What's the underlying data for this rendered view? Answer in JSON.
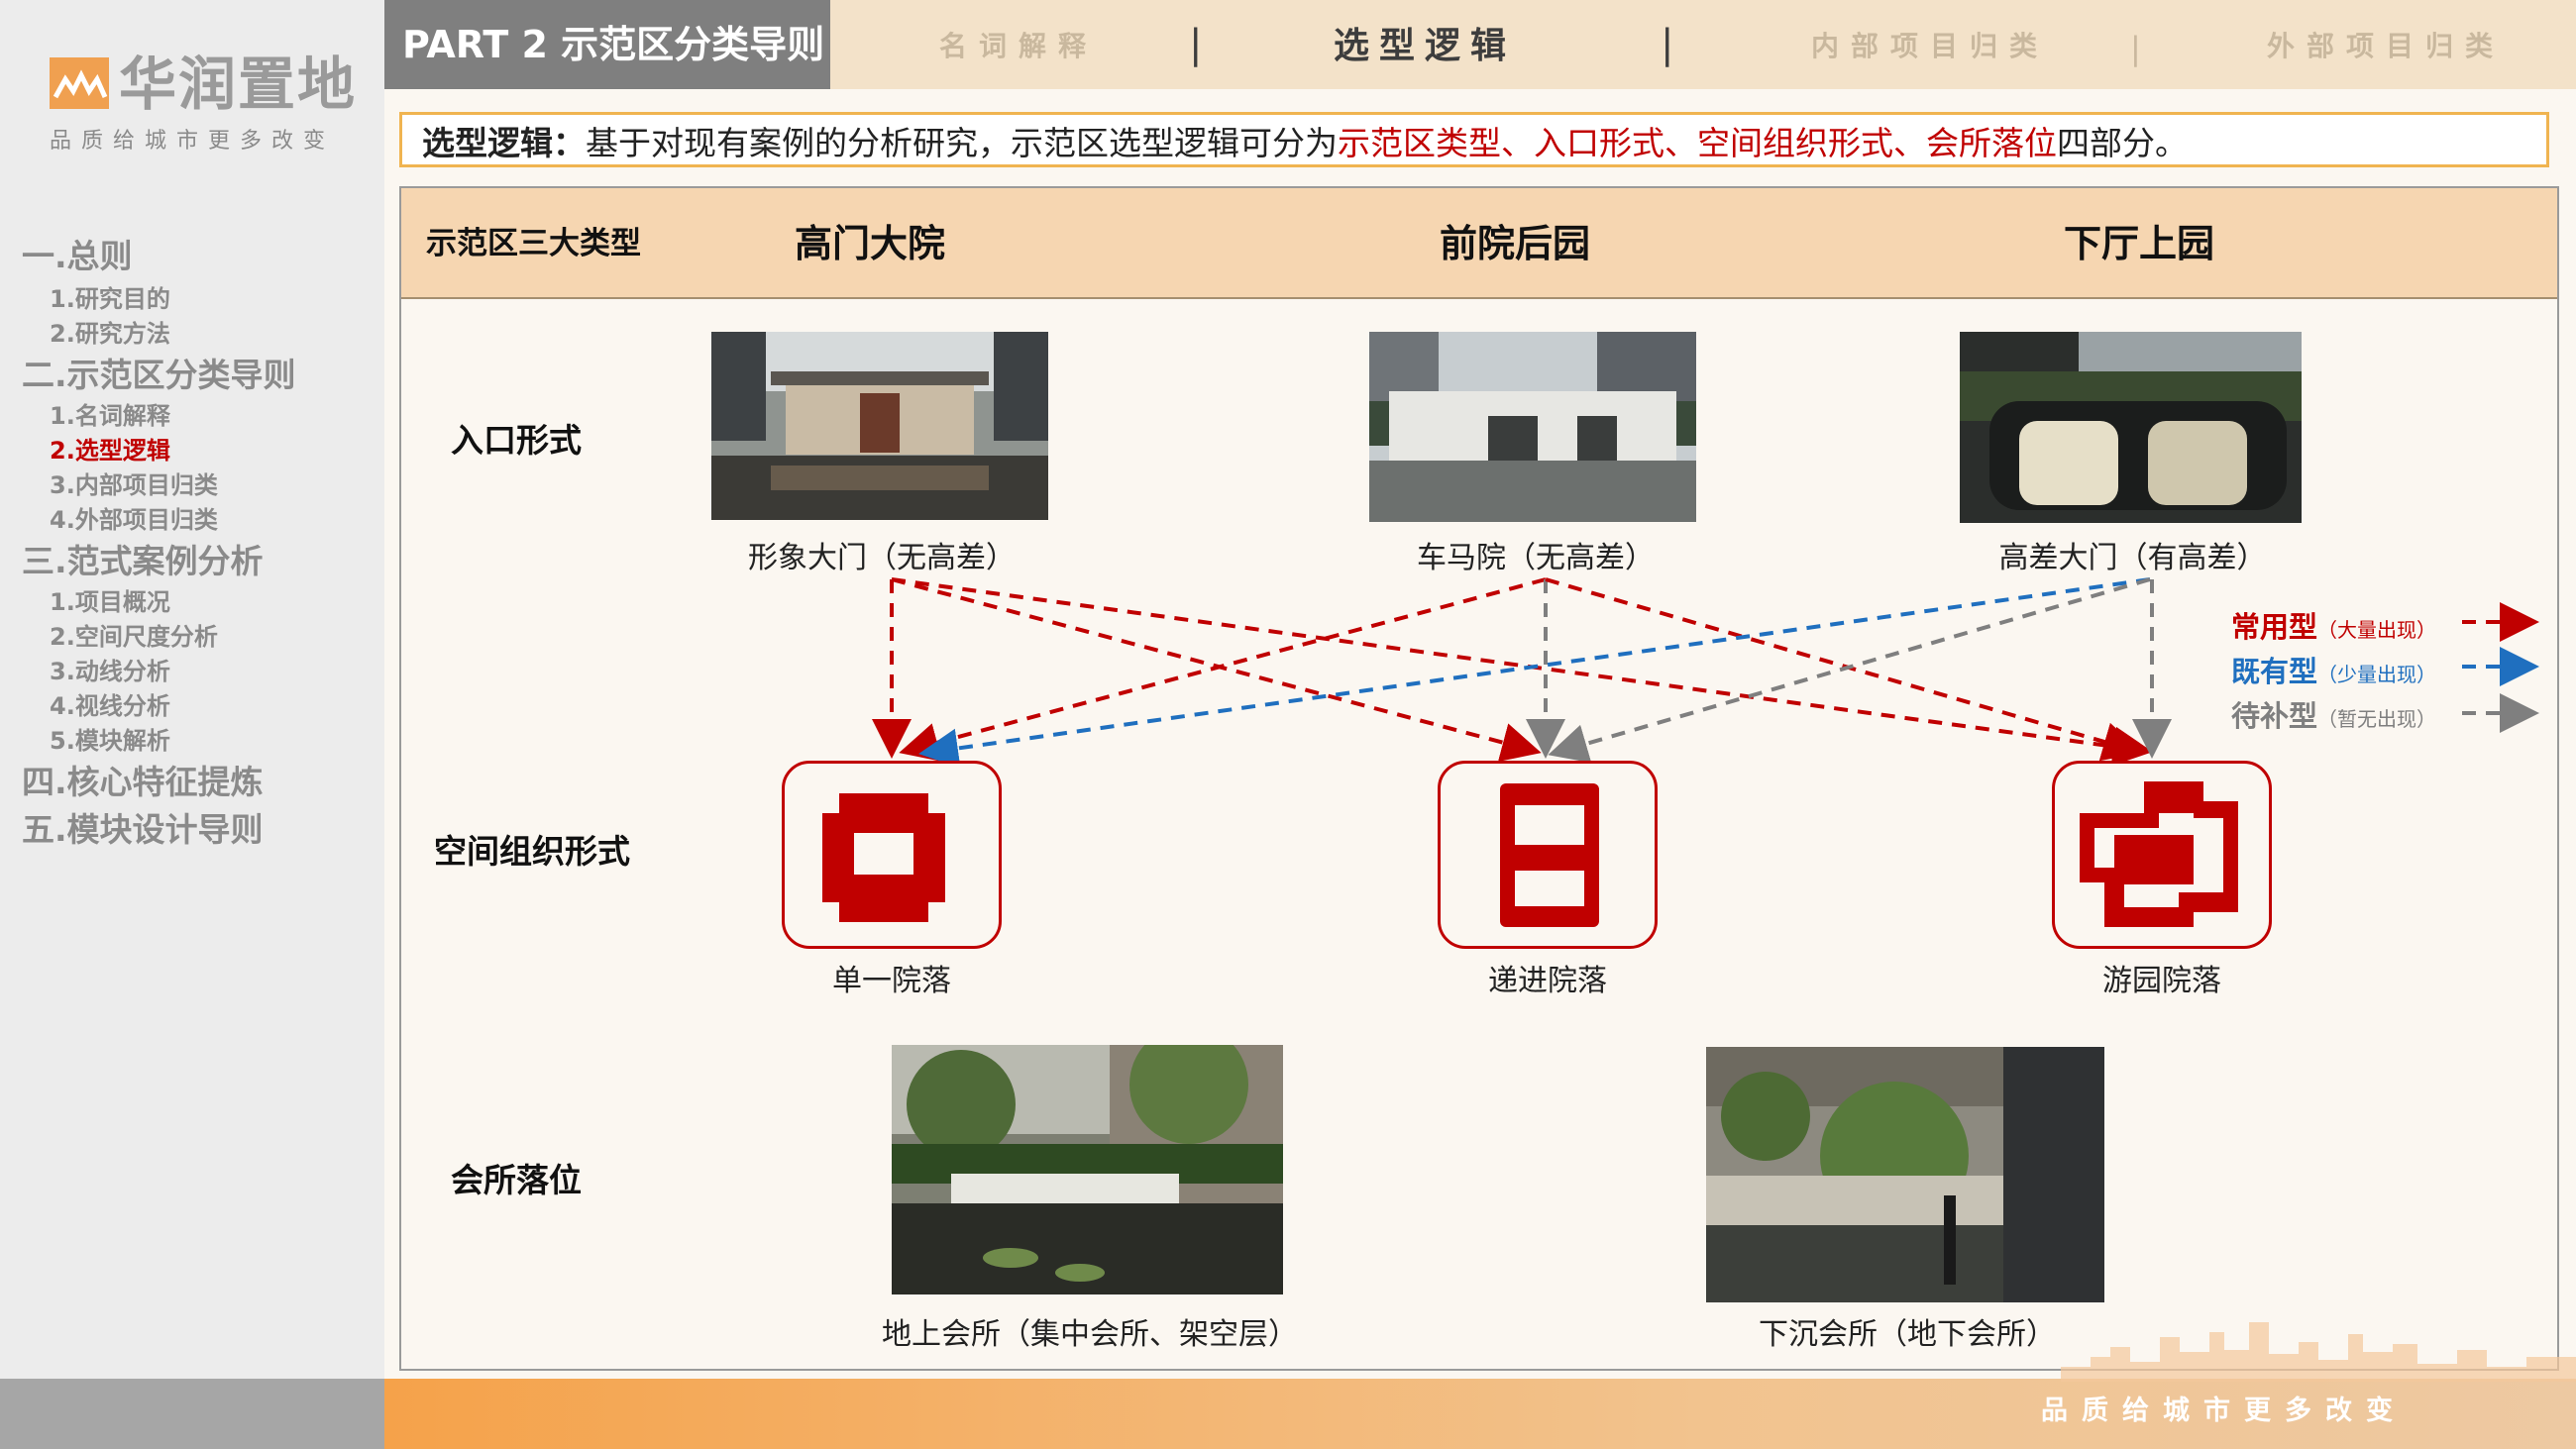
{
  "brand": {
    "name": "华润置地",
    "tagline": "品质给城市更多改变"
  },
  "sidebar": {
    "sections": [
      {
        "label": "一.总则",
        "items": [
          "1.研究目的",
          "2.研究方法"
        ]
      },
      {
        "label": "二.示范区分类导则",
        "items": [
          "1.名词解释",
          "2.选型逻辑",
          "3.内部项目归类",
          "4.外部项目归类"
        ]
      },
      {
        "label": "三.范式案例分析",
        "items": [
          "1.项目概况",
          "2.空间尺度分析",
          "3.动线分析",
          "4.视线分析",
          "5.模块解析"
        ]
      },
      {
        "label": "四.核心特征提炼",
        "items": []
      },
      {
        "label": "五.模块设计导则",
        "items": []
      }
    ],
    "active_item": "2.选型逻辑"
  },
  "header": {
    "part_title": "PART 2 示范区分类导则",
    "tabs": [
      "名词解释",
      "选型逻辑",
      "内部项目归类",
      "外部项目归类"
    ],
    "active_tab": "选型逻辑",
    "separator": "|"
  },
  "intro": {
    "label": "选型逻辑：",
    "text_before": "基于对现有案例的分析研究，示范区选型逻辑可分为",
    "highlight": "示范区类型、入口形式、空间组织形式、会所落位",
    "text_after": "四部分。"
  },
  "table": {
    "corner": "示范区三大类型",
    "columns": [
      "高门大院",
      "前院后园",
      "下厅上园"
    ],
    "rows": {
      "entrance": "入口形式",
      "space": "空间组织形式",
      "club": "会所落位"
    },
    "entrance_captions": [
      "形象大门（无高差）",
      "车马院（无高差）",
      "高差大门（有高差）"
    ],
    "space_captions": [
      "单一院落",
      "递进院落",
      "游园院落"
    ],
    "club_captions": [
      "地上会所（集中会所、架空层）",
      "下沉会所（地下会所）"
    ]
  },
  "legend": [
    {
      "name": "常用型",
      "note": "（大量出现）",
      "color": "#c00000"
    },
    {
      "name": "既有型",
      "note": "（少量出现）",
      "color": "#1f6fbf"
    },
    {
      "name": "待补型",
      "note": "（暂无出现）",
      "color": "#7f7f7f"
    }
  ],
  "colors": {
    "accent_red": "#c00000",
    "header_bg": "#f6d6b1",
    "nav_bg": "#f3e2c9",
    "dark_gray": "#7f7f7f",
    "blue": "#1f6fbf",
    "orange": "#f5a24a"
  }
}
